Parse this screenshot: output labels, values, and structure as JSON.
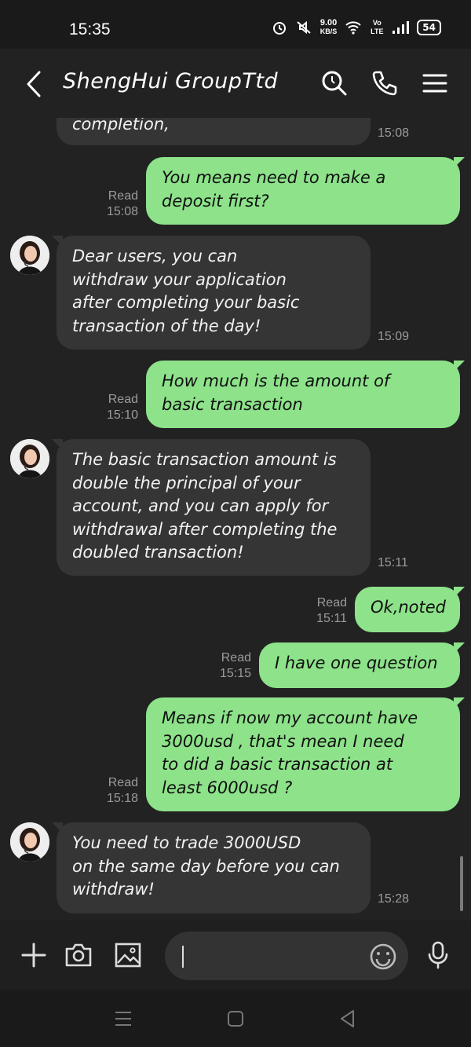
{
  "status": {
    "time": "15:35",
    "net_speed_value": "9.00",
    "net_speed_unit": "KB/S",
    "lte": "Vo LTE",
    "battery": "54"
  },
  "header": {
    "title": "ShengHui GroupTtd"
  },
  "messages": [
    {
      "dir": "in",
      "text": "completion,",
      "time": "15:08"
    },
    {
      "dir": "out",
      "line1": "You means need to make a",
      "line2": "deposit first?",
      "read": "Read",
      "time": "15:08"
    },
    {
      "dir": "in",
      "line1": "Dear users, you can",
      "line2": "withdraw your application",
      "line3": "after completing your basic",
      "line4": "transaction of the day!",
      "time": "15:09"
    },
    {
      "dir": "out",
      "line1": "How much is the amount of",
      "line2": "basic transaction",
      "read": "Read",
      "time": "15:10"
    },
    {
      "dir": "in",
      "line1": "The basic transaction amount is",
      "line2": "double the principal of your",
      "line3": "account, and you can apply for",
      "line4": "withdrawal after completing the",
      "line5": "doubled transaction!",
      "time": "15:11"
    },
    {
      "dir": "out",
      "text": "Ok,noted",
      "read": "Read",
      "time": "15:11"
    },
    {
      "dir": "out",
      "text": "I have one question",
      "read": "Read",
      "time": "15:15"
    },
    {
      "dir": "out",
      "line1": "Means if now my account have",
      "line2": "3000usd , that's mean I need",
      "line3": "to did a basic transaction at",
      "line4": "least 6000usd ?",
      "read": "Read",
      "time": "15:18"
    },
    {
      "dir": "in",
      "line1": "You need to trade 3000USD",
      "line2": "on the same day before you can",
      "line3": "withdraw!",
      "time": "15:28"
    }
  ],
  "input": {
    "value": "",
    "placeholder": ""
  },
  "icons": {
    "back": "back-arrow-icon",
    "search": "search-icon",
    "call": "phone-icon",
    "menu": "menu-icon",
    "add": "plus-icon",
    "camera": "camera-icon",
    "gallery": "image-icon",
    "emoji": "emoji-icon",
    "mic": "microphone-icon"
  },
  "colors": {
    "outgoing_bubble": "#8de28a",
    "incoming_bubble": "#353535",
    "background": "#222222"
  }
}
